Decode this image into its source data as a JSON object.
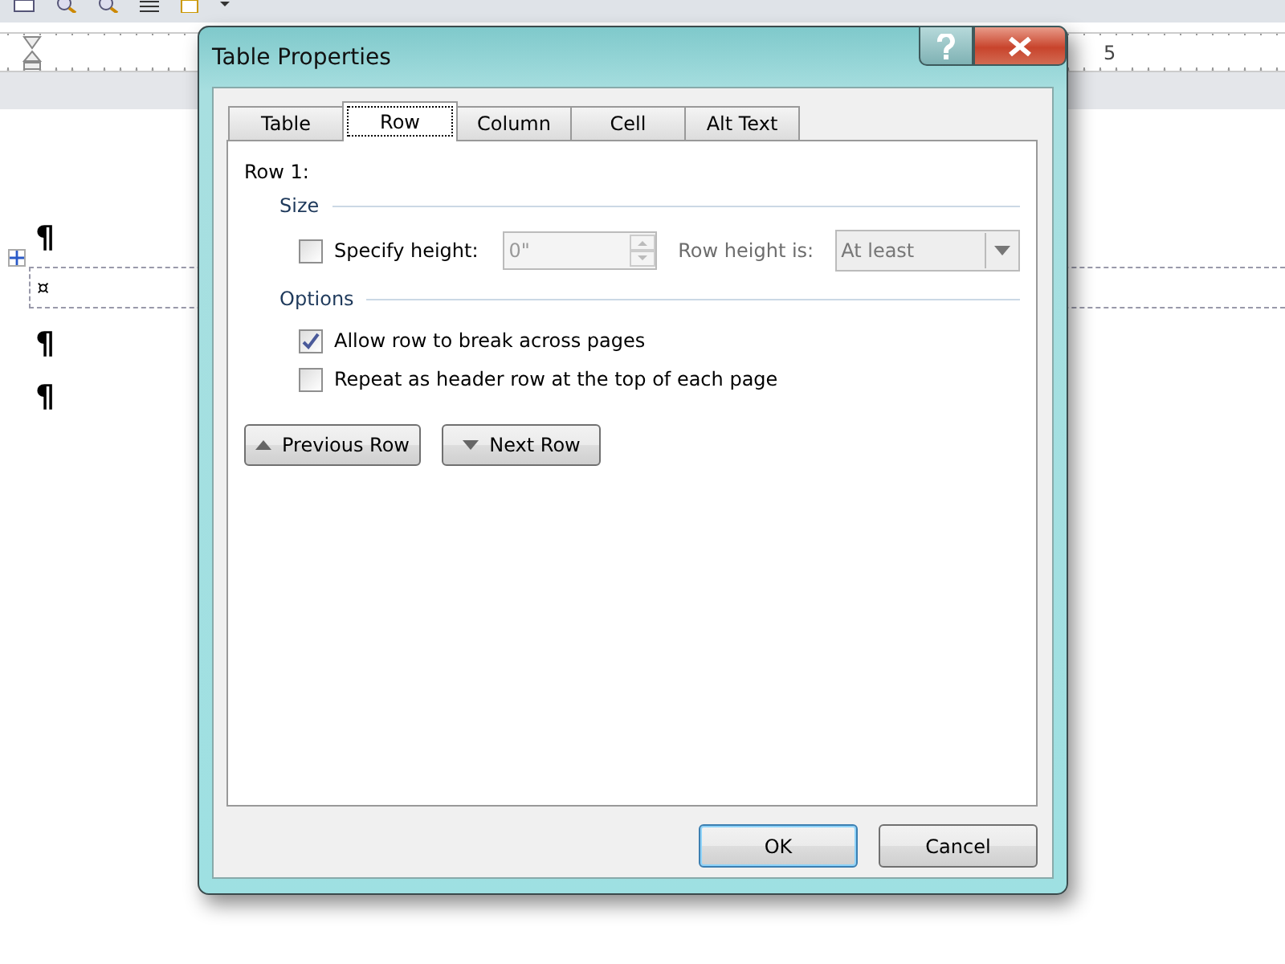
{
  "document": {
    "ruler_label": "5",
    "marks": [
      {
        "kind": "para",
        "text": "¶"
      },
      {
        "kind": "cell",
        "text": "¤"
      },
      {
        "kind": "para",
        "text": "¶"
      },
      {
        "kind": "para",
        "text": "¶"
      }
    ]
  },
  "dialog": {
    "title": "Table Properties",
    "tabs": [
      {
        "label": "Table",
        "selected": false
      },
      {
        "label": "Row",
        "selected": true
      },
      {
        "label": "Column",
        "selected": false
      },
      {
        "label": "Cell",
        "selected": false
      },
      {
        "label": "Alt Text",
        "selected": false
      }
    ],
    "heading": "Row 1:",
    "size_group": {
      "title": "Size",
      "specify_height": {
        "label": "Specify height:",
        "checked": false
      },
      "height_value": "0\"",
      "row_height_label": "Row height is:",
      "row_height_value": "At least",
      "disabled": true
    },
    "options_group": {
      "title": "Options",
      "checkboxes": [
        {
          "label": "Allow row to break across pages",
          "checked": true
        },
        {
          "label": "Repeat as header row at the top of each page",
          "checked": false
        }
      ]
    },
    "nav_buttons": [
      {
        "label": "Previous Row"
      },
      {
        "label": "Next Row"
      }
    ],
    "buttons": [
      {
        "label": "OK",
        "default": true
      },
      {
        "label": "Cancel",
        "default": false
      }
    ]
  }
}
